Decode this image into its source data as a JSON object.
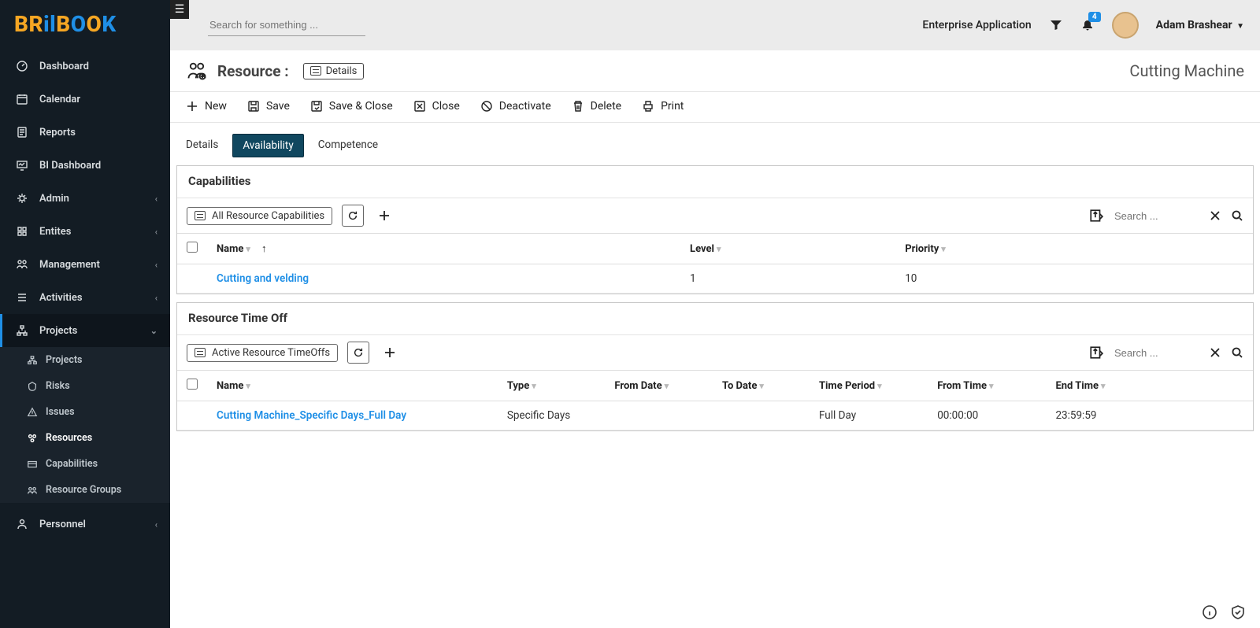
{
  "header": {
    "search_placeholder": "Search for something ...",
    "app_name": "Enterprise Application",
    "notification_count": "4",
    "username": "Adam Brashear"
  },
  "sidebar": {
    "items": [
      {
        "label": "Dashboard"
      },
      {
        "label": "Calendar"
      },
      {
        "label": "Reports"
      },
      {
        "label": "BI Dashboard"
      },
      {
        "label": "Admin"
      },
      {
        "label": "Entites"
      },
      {
        "label": "Management"
      },
      {
        "label": "Activities"
      },
      {
        "label": "Projects"
      },
      {
        "label": "Personnel"
      }
    ],
    "projects_sub": [
      {
        "label": "Projects"
      },
      {
        "label": "Risks"
      },
      {
        "label": "Issues"
      },
      {
        "label": "Resources"
      },
      {
        "label": "Capabilities"
      },
      {
        "label": "Resource Groups"
      }
    ]
  },
  "page": {
    "entity": "Resource :",
    "view_label": "Details",
    "record_title": "Cutting Machine"
  },
  "toolbar": {
    "new": "New",
    "save": "Save",
    "save_close": "Save & Close",
    "close": "Close",
    "deactivate": "Deactivate",
    "delete": "Delete",
    "print": "Print"
  },
  "tabs": {
    "details": "Details",
    "availability": "Availability",
    "competence": "Competence"
  },
  "capabilities": {
    "title": "Capabilities",
    "view": "All Resource Capabilities",
    "search_placeholder": "Search ...",
    "columns": {
      "name": "Name",
      "level": "Level",
      "priority": "Priority"
    },
    "rows": [
      {
        "name": "Cutting and velding",
        "level": "1",
        "priority": "10"
      }
    ]
  },
  "timeoff": {
    "title": "Resource Time Off",
    "view": "Active Resource TimeOffs",
    "search_placeholder": "Search ...",
    "columns": {
      "name": "Name",
      "type": "Type",
      "from_date": "From Date",
      "to_date": "To Date",
      "time_period": "Time Period",
      "from_time": "From Time",
      "end_time": "End Time"
    },
    "rows": [
      {
        "name": "Cutting Machine_Specific Days_Full Day",
        "type": "Specific Days",
        "from_date": "",
        "to_date": "",
        "time_period": "Full Day",
        "from_time": "00:00:00",
        "end_time": "23:59:59"
      }
    ]
  }
}
